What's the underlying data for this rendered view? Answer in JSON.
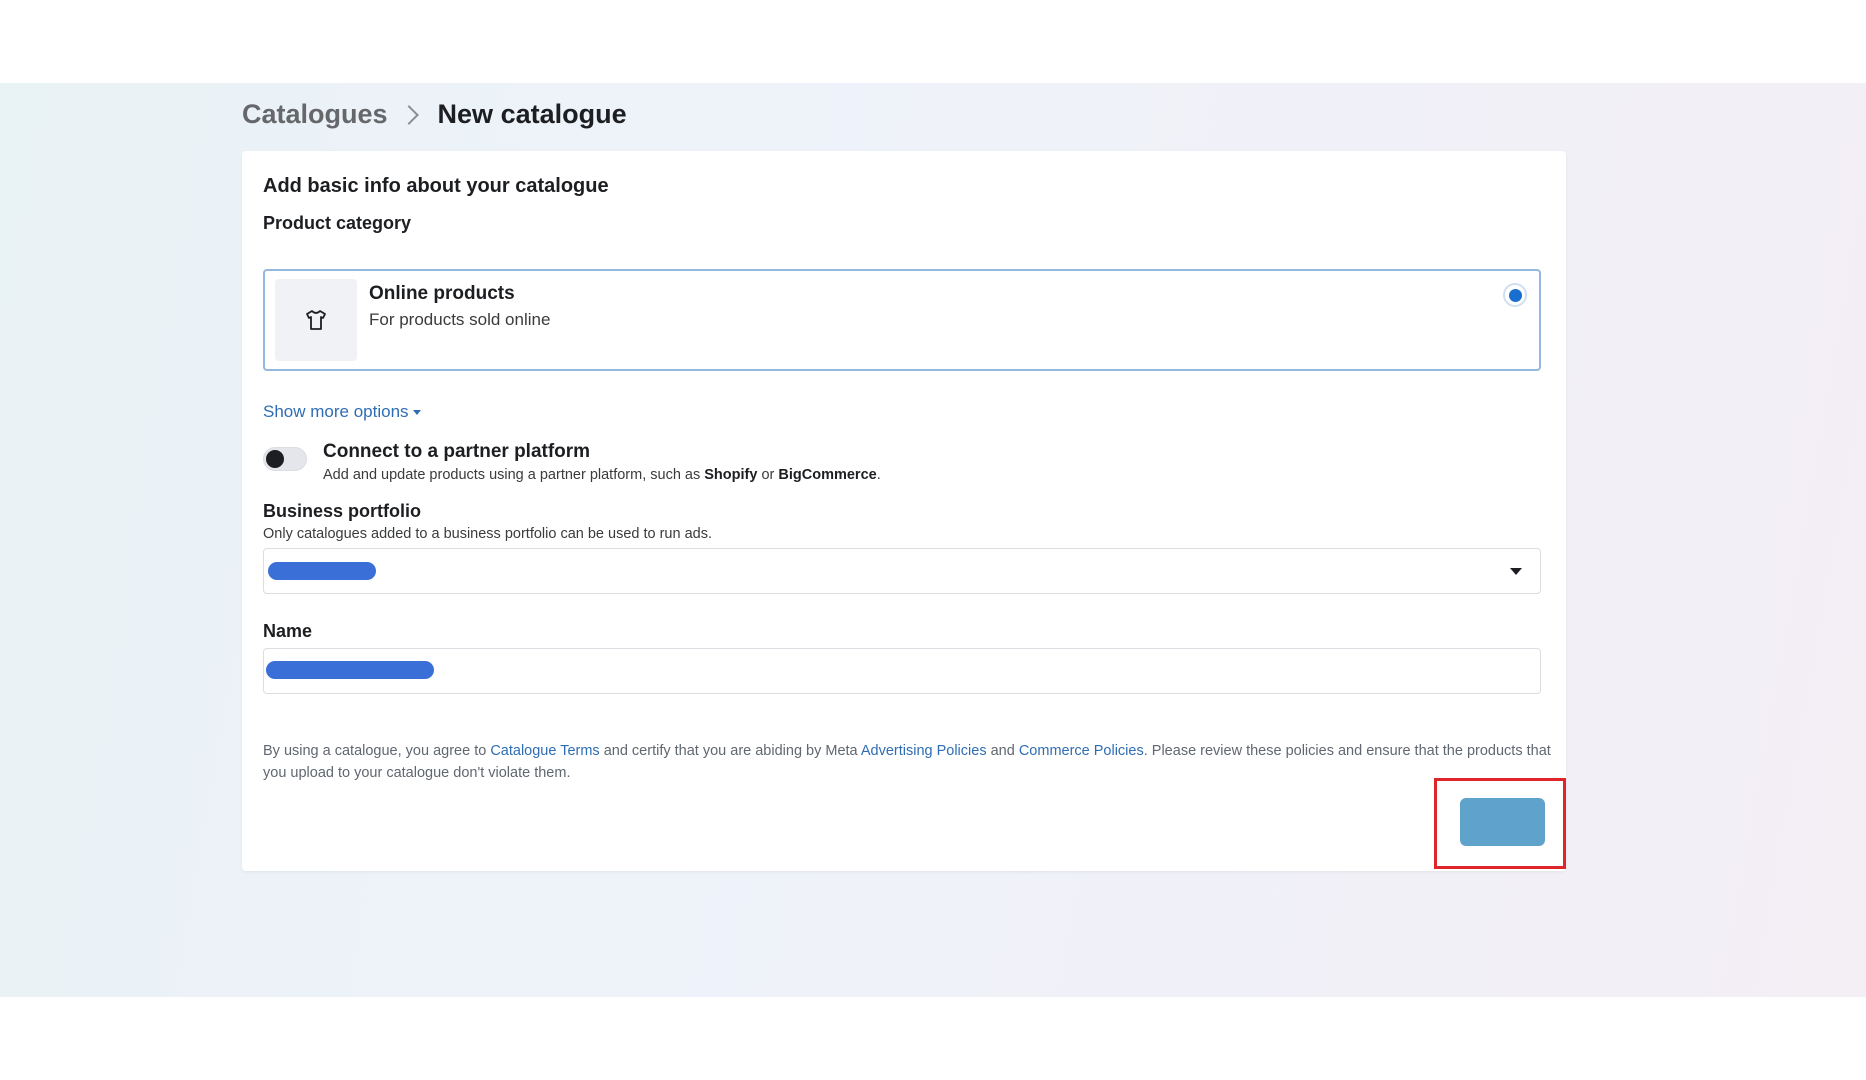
{
  "breadcrumb": {
    "parent": "Catalogues",
    "current": "New catalogue"
  },
  "form": {
    "title": "Add basic info about your catalogue",
    "product_category_label": "Product category",
    "option": {
      "title": "Online products",
      "subtitle": "For products sold online",
      "icon": "tshirt-icon",
      "selected": true
    },
    "show_more": "Show more options",
    "partner": {
      "title": "Connect to a partner platform",
      "desc_prefix": "Add and update products using a partner platform, such as ",
      "shopify": "Shopify",
      "or": " or ",
      "bigcommerce": "BigCommerce",
      "period": ".",
      "enabled": false
    },
    "business_portfolio": {
      "label": "Business portfolio",
      "help": "Only catalogues added to a business portfolio can be used to run ads.",
      "value_redacted": true
    },
    "name": {
      "label": "Name",
      "value_redacted": true
    },
    "legal": {
      "p1": "By using a catalogue, you agree to ",
      "link1": "Catalogue Terms",
      "p2": " and certify that you are abiding by Meta ",
      "link2": "Advertising Policies",
      "p3": " and ",
      "link3": "Commerce Policies",
      "p4": ". Please review these policies and ensure that the products that you upload to your catalogue don't violate them."
    },
    "submit_button_color": "#5fa3cc",
    "highlight_color": "#e0242b"
  },
  "colors": {
    "link": "#2f6db3",
    "radio_selected": "#1a6ed0",
    "redaction": "#3b6fd8"
  }
}
